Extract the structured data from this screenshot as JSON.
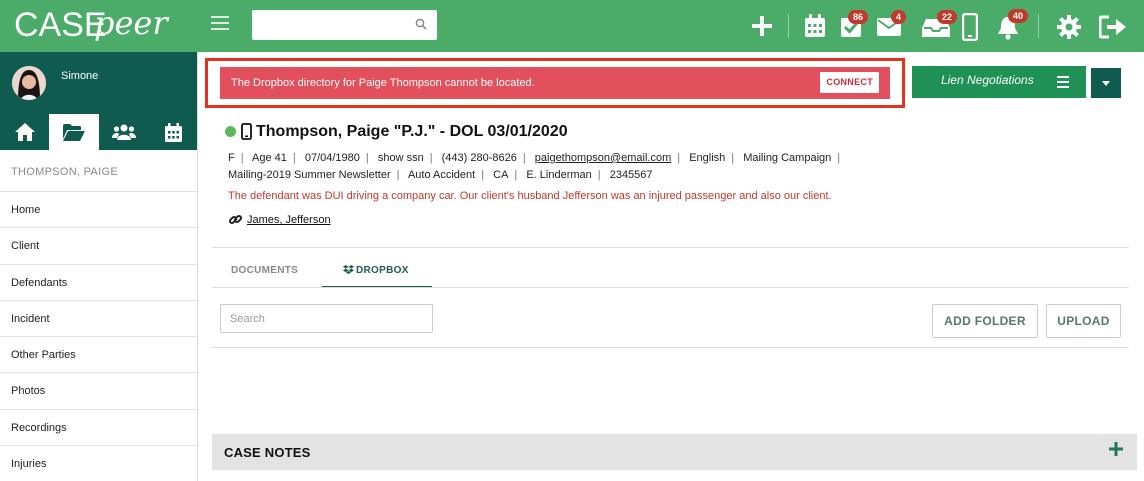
{
  "app": {
    "logo_case": "CASE",
    "logo_peer": "peer",
    "top_search": {
      "placeholder": "",
      "value": ""
    },
    "badges": {
      "tasks": "86",
      "mail": "4",
      "inbox": "22",
      "notifications": "40"
    }
  },
  "sidebar": {
    "username": "Simone",
    "case_label": "THOMPSON, PAIGE",
    "nav_items": [
      {
        "label": "Home"
      },
      {
        "label": "Client"
      },
      {
        "label": "Defendants"
      },
      {
        "label": "Incident"
      },
      {
        "label": "Other Parties"
      },
      {
        "label": "Photos"
      },
      {
        "label": "Recordings"
      },
      {
        "label": "Injuries"
      }
    ]
  },
  "alert": {
    "message": "The Dropbox directory for Paige Thompson cannot be located.",
    "connect_label": "CONNECT"
  },
  "lien": {
    "label": "Lien Negotiations"
  },
  "client": {
    "title": "Thompson, Paige \"P.J.\" - DOL 03/01/2020",
    "line1": [
      "F",
      "Age 41",
      "07/04/1980",
      "show ssn",
      "(443) 280-8626"
    ],
    "email": "paigethompson@email.com",
    "line1b": [
      "English",
      "Mailing Campaign"
    ],
    "line2": [
      "Mailing-2019 Summer Newsletter",
      "Auto Accident",
      "CA",
      "E. Linderman",
      "2345567"
    ],
    "description": "The defendant was DUI driving a company car. Our client's husband Jefferson was an injured passenger and also our client.",
    "related": "James, Jefferson"
  },
  "tabs": {
    "documents": "DOCUMENTS",
    "dropbox": "DROPBOX"
  },
  "files": {
    "search_placeholder": "Search",
    "add_folder_label": "ADD FOLDER",
    "upload_label": "UPLOAD"
  },
  "notes": {
    "title": "CASE NOTES"
  },
  "colors": {
    "brand": "#4bac6a",
    "dark_green": "#0f5b4f",
    "alert": "#e24f5d",
    "highlight": "#e5321f"
  }
}
